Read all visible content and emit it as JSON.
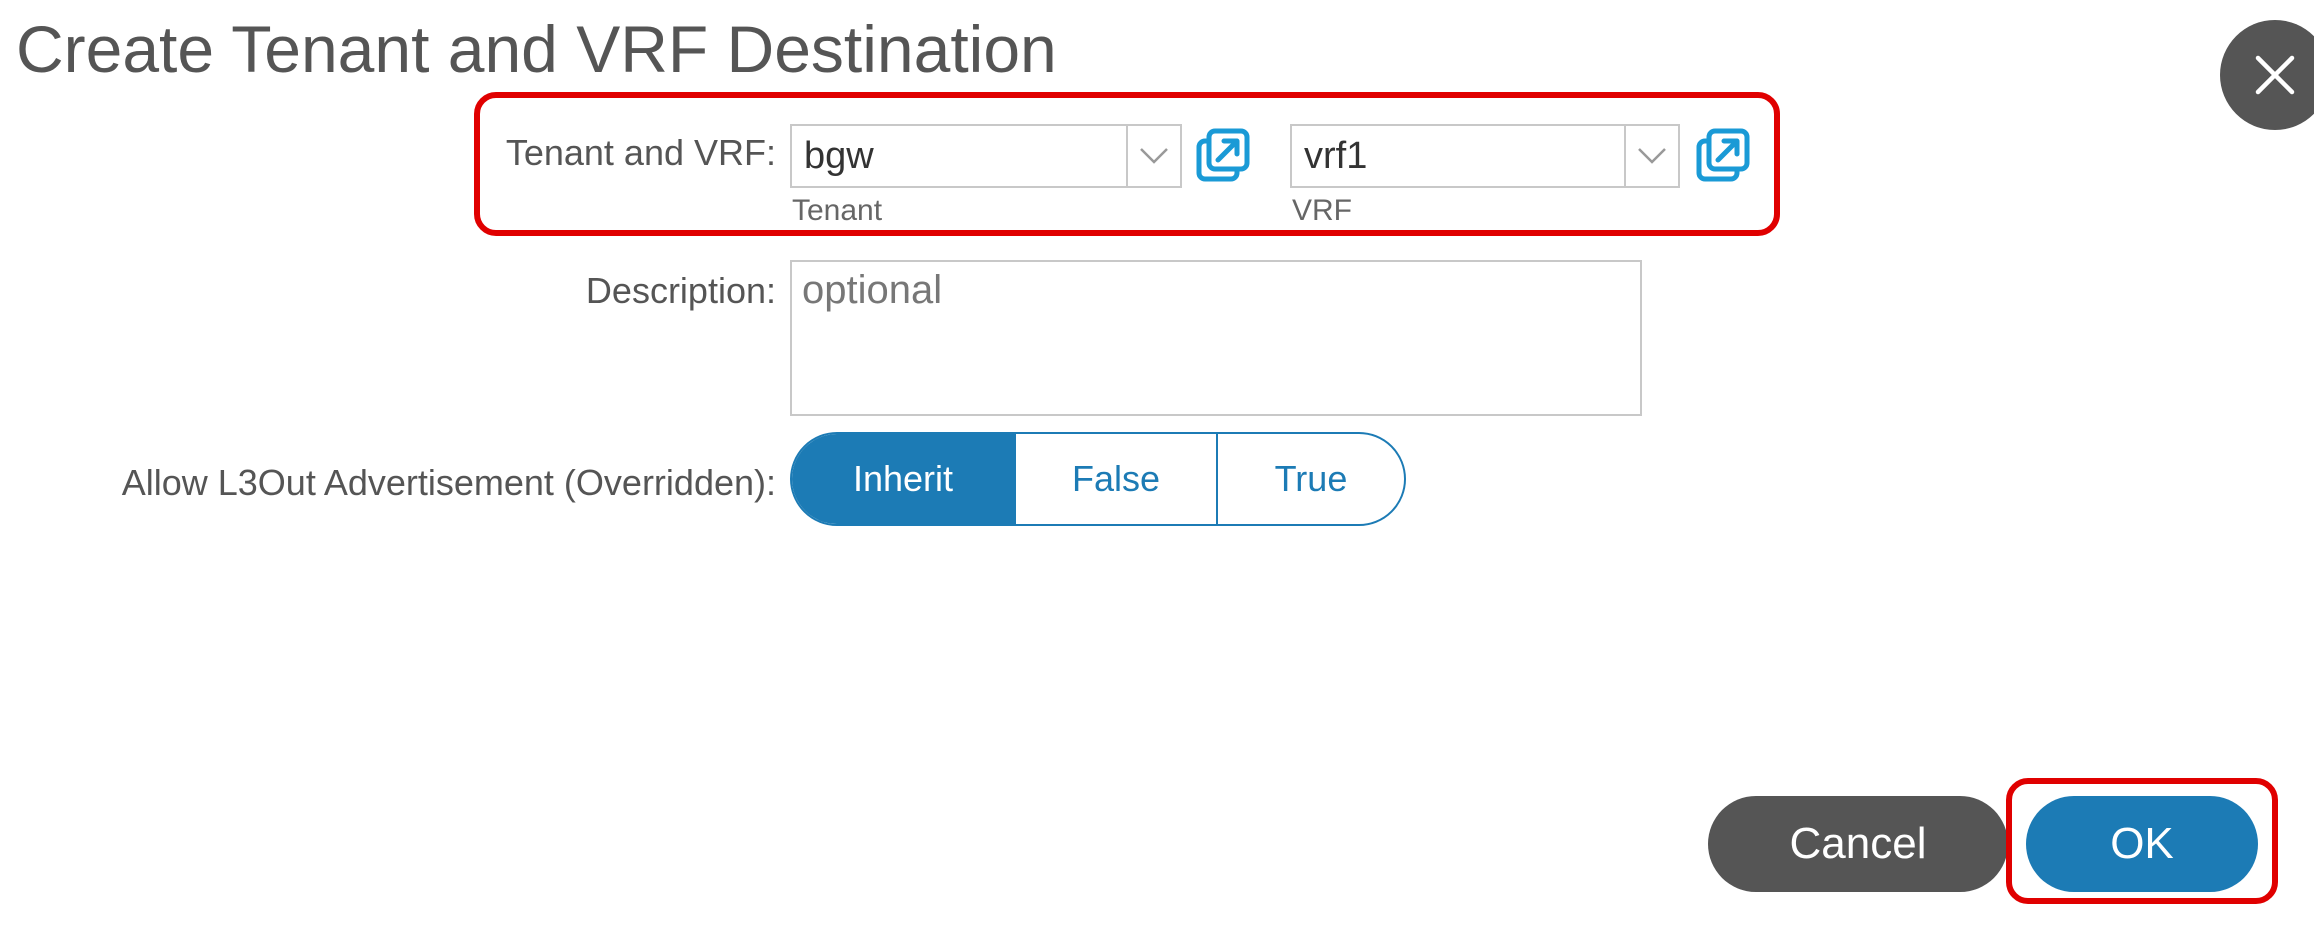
{
  "dialog": {
    "title": "Create Tenant and VRF Destination"
  },
  "tenant_vrf": {
    "label": "Tenant and VRF:",
    "tenant": {
      "value": "bgw",
      "sublabel": "Tenant"
    },
    "vrf": {
      "value": "vrf1",
      "sublabel": "VRF"
    }
  },
  "description": {
    "label": "Description:",
    "placeholder": "optional",
    "value": ""
  },
  "advertisement": {
    "label": "Allow L3Out Advertisement (Overridden):",
    "options": [
      "Inherit",
      "False",
      "True"
    ],
    "selected": "Inherit"
  },
  "footer": {
    "cancel_label": "Cancel",
    "ok_label": "OK"
  },
  "colors": {
    "accent": "#1c7bb5",
    "highlight": "#e00000",
    "cancel_bg": "#555555",
    "link_icon": "#1a9ad6"
  },
  "icons": {
    "close": "close-icon",
    "dropdown": "chevron-down-icon",
    "open": "external-link-icon"
  }
}
